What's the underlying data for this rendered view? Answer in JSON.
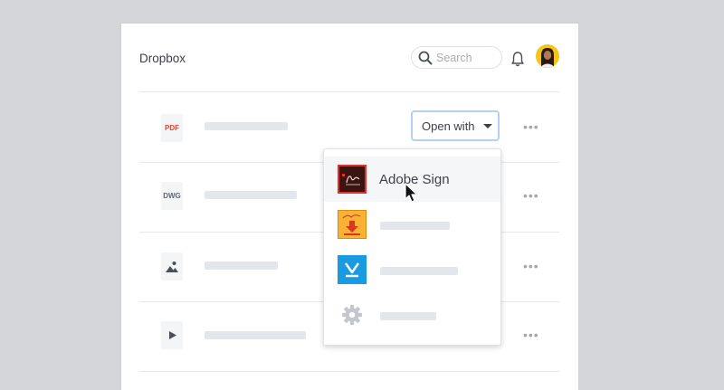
{
  "app": {
    "title": "Dropbox"
  },
  "search": {
    "placeholder": "Search"
  },
  "icons": {
    "search": "search-icon",
    "bell": "bell-icon",
    "more": "more-horizontal-icon",
    "settings": "gear-icon"
  },
  "files": [
    {
      "type_label": "PDF",
      "type_color": "#e8452c"
    },
    {
      "type_label": "DWG",
      "type_color": "#5f6670"
    },
    {
      "type_label": "",
      "icon": "image-icon"
    },
    {
      "type_label": "",
      "icon": "play-icon"
    }
  ],
  "open_with": {
    "label": "Open with"
  },
  "menu": {
    "items": [
      {
        "label": "Adobe Sign",
        "icon": "adobe-sign-app-icon"
      },
      {
        "label": "",
        "icon": "ez-sign-app-icon"
      },
      {
        "label": "",
        "icon": "docusign-app-icon"
      },
      {
        "label": "",
        "icon": "gear-icon"
      }
    ]
  },
  "colors": {
    "background": "#d3d5d9",
    "accent_focus": "#b7cff0",
    "placeholder_bar": "#e3e6ea",
    "avatar_bg": "#f5c518"
  }
}
